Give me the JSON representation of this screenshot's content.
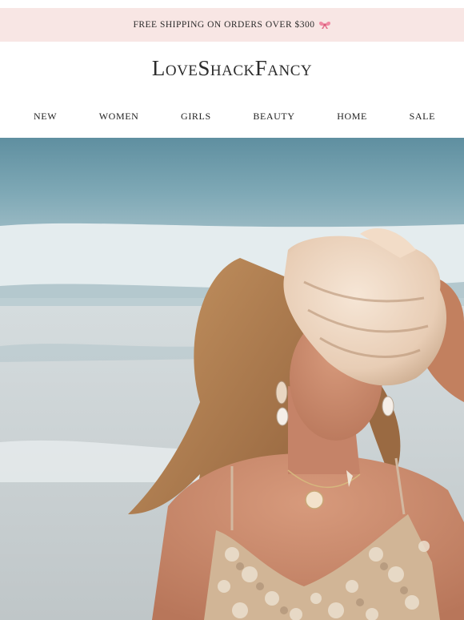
{
  "promo": {
    "text": "FREE SHIPPING ON ORDERS OVER $300",
    "icon": "bow-icon"
  },
  "brand": {
    "logo": "LoveShackFancy"
  },
  "nav": {
    "items": [
      {
        "label": "NEW"
      },
      {
        "label": "WOMEN"
      },
      {
        "label": "GIRLS"
      },
      {
        "label": "BEAUTY"
      },
      {
        "label": "HOME"
      },
      {
        "label": "SALE"
      }
    ]
  },
  "hero": {
    "description_icon": "hero-photo",
    "colors": {
      "sea": "#6f9fae",
      "foam": "#dfe8ea",
      "sand": "#c9cfd1",
      "skin": "#c9876a",
      "hair": "#b07c4f",
      "shell": "#efd8c3",
      "sequin": "#d3b99c"
    }
  },
  "colors": {
    "promo_bg": "#f8e6e4",
    "text": "#222222"
  }
}
